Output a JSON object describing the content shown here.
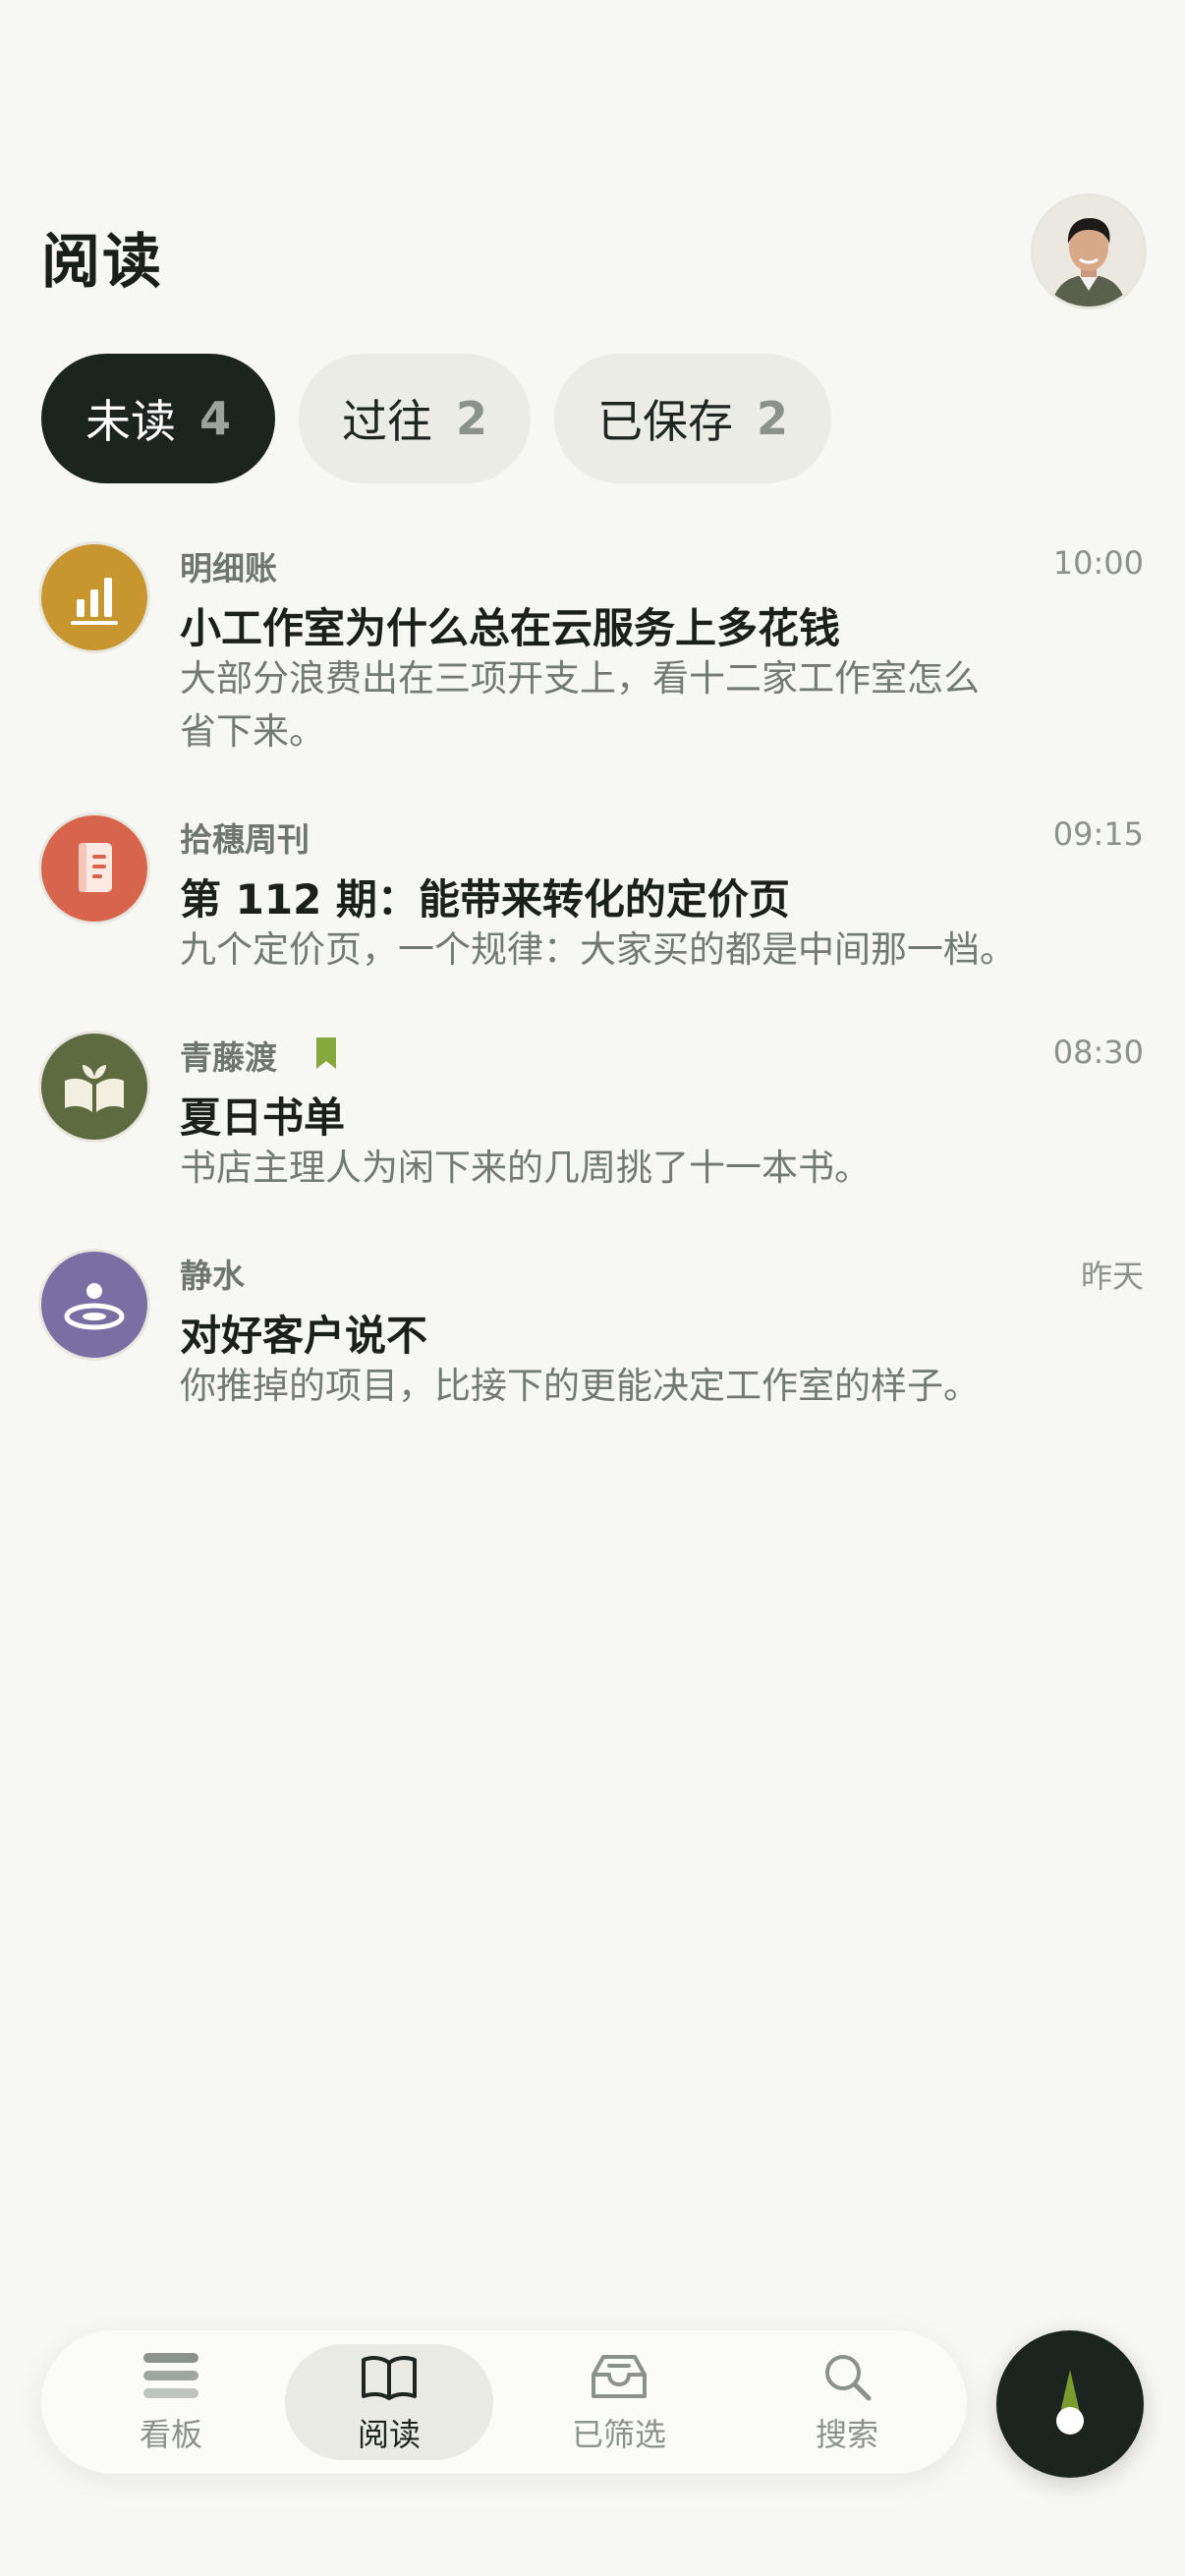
{
  "header": {
    "title": "阅读"
  },
  "tabs": [
    {
      "label": "未读",
      "count": "4"
    },
    {
      "label": "过往",
      "count": "2"
    },
    {
      "label": "已保存",
      "count": "2"
    }
  ],
  "feed": [
    {
      "source": "明细账",
      "time": "10:00",
      "title": "小工作室为什么总在云服务上多花钱",
      "summary": "大部分浪费出在三项开支上，看十二家工作室怎么省下来。",
      "icon": "bar-chart-icon",
      "color": "#c7962f"
    },
    {
      "source": "拾穗周刊",
      "time": "09:15",
      "title": "第 112 期：能带来转化的定价页",
      "summary": "九个定价页，一个规律：大家买的都是中间那一档。",
      "icon": "notebook-icon",
      "color": "#d7654c"
    },
    {
      "source": "青藤渡",
      "time": "08:30",
      "title": "夏日书单",
      "summary": "书店主理人为闲下来的几周挑了十一本书。",
      "icon": "open-book-sprout-icon",
      "color": "#5e6b40",
      "saved": true
    },
    {
      "source": "静水",
      "time": "昨天",
      "title": "对好客户说不",
      "summary": "你推掉的项目，比接下的更能决定工作室的样子。",
      "icon": "ripple-drop-icon",
      "color": "#7a6fa3"
    }
  ],
  "nav": [
    {
      "label": "看板",
      "icon": "stack-icon"
    },
    {
      "label": "阅读",
      "icon": "book-icon"
    },
    {
      "label": "已筛选",
      "icon": "inbox-icon"
    },
    {
      "label": "搜索",
      "icon": "search-icon"
    }
  ],
  "colors": {
    "accent": "#1c2420",
    "background": "#f7f7f3",
    "saved_marker": "#86a83c"
  }
}
